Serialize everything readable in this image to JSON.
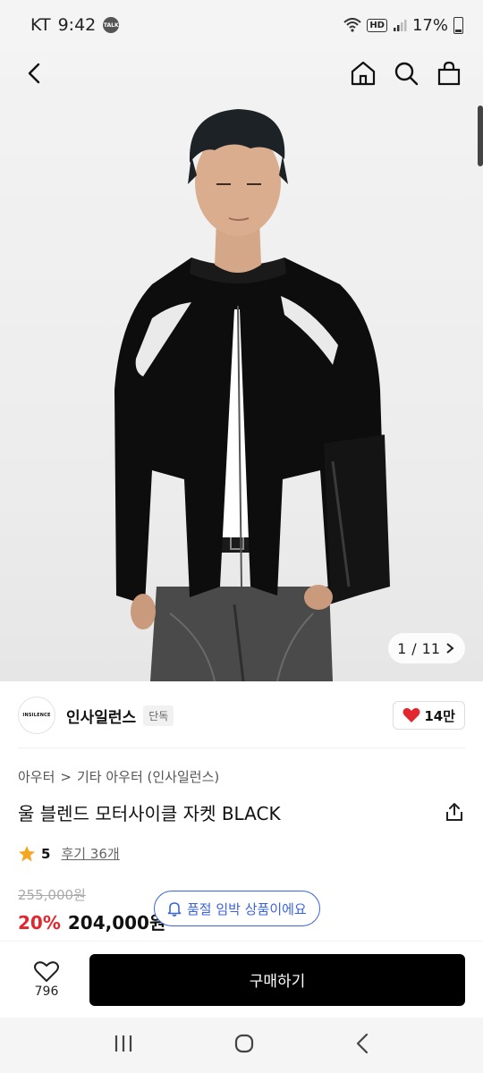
{
  "status": {
    "carrier": "KT",
    "time": "9:42",
    "talk_badge": "TALK",
    "hd": "HD",
    "battery": "17%"
  },
  "header": {
    "back_icon": "chevron-left-icon",
    "home_icon": "home-icon",
    "search_icon": "search-icon",
    "cart_icon": "shopping-bag-icon"
  },
  "gallery": {
    "current": "1",
    "total": "11",
    "separator": "/"
  },
  "brand": {
    "logo_text": "INSILENCE",
    "name": "인사일런스",
    "tag": "단독",
    "likes": "14만"
  },
  "breadcrumb": {
    "items": [
      "아우터",
      "기타 아우터 (인사일런스)"
    ],
    "separator": ">"
  },
  "product": {
    "title": "울 블렌드 모터사이클 자켓 BLACK"
  },
  "rating": {
    "score": "5",
    "review_label": "후기 36개"
  },
  "price": {
    "original": "255,000원",
    "discount": "20%",
    "sale": "204,000원",
    "soldout_notice": "품절 임박 상품이에요"
  },
  "actions": {
    "wish_count": "796",
    "buy_label": "구매하기"
  },
  "colors": {
    "accent_red": "#e2262d",
    "accent_blue": "#3b63e0",
    "buy_bg": "#000000"
  }
}
